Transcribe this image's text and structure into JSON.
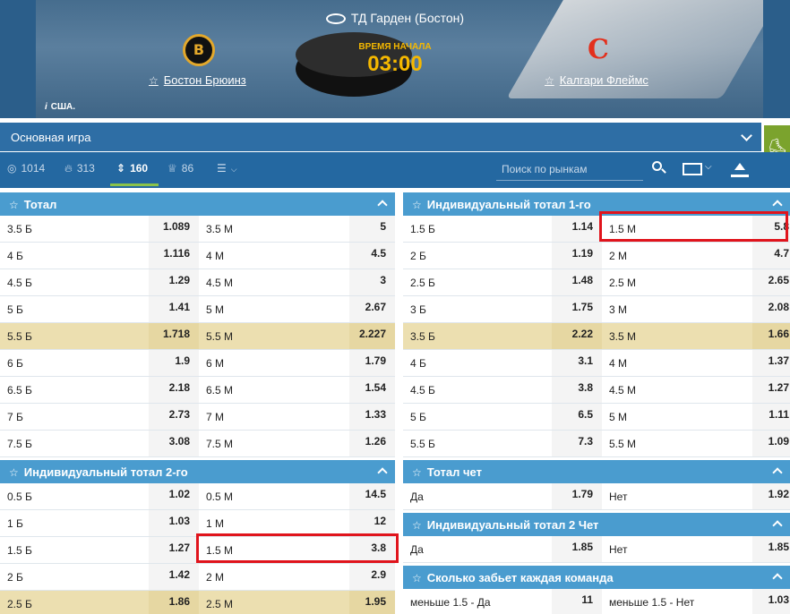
{
  "event": {
    "venue": "ТД Гарден (Бостон)",
    "home_team": "Бостон Брюинз",
    "away_team": "Калгари Флеймс",
    "start_label": "ВРЕМЯ НАЧАЛА",
    "start_time": "03:00",
    "country": "США."
  },
  "market_select": {
    "value": "Основная игра"
  },
  "filters": {
    "all": "1014",
    "hot": "313",
    "totals": "160",
    "trophy": "86"
  },
  "search": {
    "placeholder": "Поиск по рынкам"
  },
  "markets": {
    "total": {
      "title": "Тотал",
      "rows": [
        [
          "3.5 Б",
          "1.089",
          "3.5 М",
          "5"
        ],
        [
          "4 Б",
          "1.116",
          "4 М",
          "4.5"
        ],
        [
          "4.5 Б",
          "1.29",
          "4.5 М",
          "3"
        ],
        [
          "5 Б",
          "1.41",
          "5 М",
          "2.67"
        ],
        [
          "5.5 Б",
          "1.718",
          "5.5 М",
          "2.227"
        ],
        [
          "6 Б",
          "1.9",
          "6 М",
          "1.79"
        ],
        [
          "6.5 Б",
          "2.18",
          "6.5 М",
          "1.54"
        ],
        [
          "7 Б",
          "2.73",
          "7 М",
          "1.33"
        ],
        [
          "7.5 Б",
          "3.08",
          "7.5 М",
          "1.26"
        ]
      ]
    },
    "ind_total_2": {
      "title": "Индивидуальный тотал 2-го",
      "rows": [
        [
          "0.5 Б",
          "1.02",
          "0.5 М",
          "14.5"
        ],
        [
          "1 Б",
          "1.03",
          "1 М",
          "12"
        ],
        [
          "1.5 Б",
          "1.27",
          "1.5 М",
          "3.8"
        ],
        [
          "2 Б",
          "1.42",
          "2 М",
          "2.9"
        ],
        [
          "2.5 Б",
          "1.86",
          "2.5 М",
          "1.95"
        ]
      ]
    },
    "ind_total_1": {
      "title": "Индивидуальный тотал 1-го",
      "rows": [
        [
          "1.5 Б",
          "1.14",
          "1.5 М",
          "5.8"
        ],
        [
          "2 Б",
          "1.19",
          "2 М",
          "4.7"
        ],
        [
          "2.5 Б",
          "1.48",
          "2.5 М",
          "2.65"
        ],
        [
          "3 Б",
          "1.75",
          "3 М",
          "2.08"
        ],
        [
          "3.5 Б",
          "2.22",
          "3.5 М",
          "1.66"
        ],
        [
          "4 Б",
          "3.1",
          "4 М",
          "1.37"
        ],
        [
          "4.5 Б",
          "3.8",
          "4.5 М",
          "1.27"
        ],
        [
          "5 Б",
          "6.5",
          "5 М",
          "1.11"
        ],
        [
          "5.5 Б",
          "7.3",
          "5.5 М",
          "1.09"
        ]
      ]
    },
    "total_even": {
      "title": "Тотал чет",
      "rows": [
        [
          "Да",
          "1.79",
          "Нет",
          "1.92"
        ]
      ]
    },
    "ind_total_2_even": {
      "title": "Индивидуальный тотал 2 Чет",
      "rows": [
        [
          "Да",
          "1.85",
          "Нет",
          "1.85"
        ]
      ]
    },
    "each_team_goals": {
      "title": "Сколько забьет каждая команда",
      "rows": [
        [
          "меньше 1.5 - Да",
          "11",
          "меньше 1.5 - Нет",
          "1.03"
        ]
      ]
    }
  }
}
